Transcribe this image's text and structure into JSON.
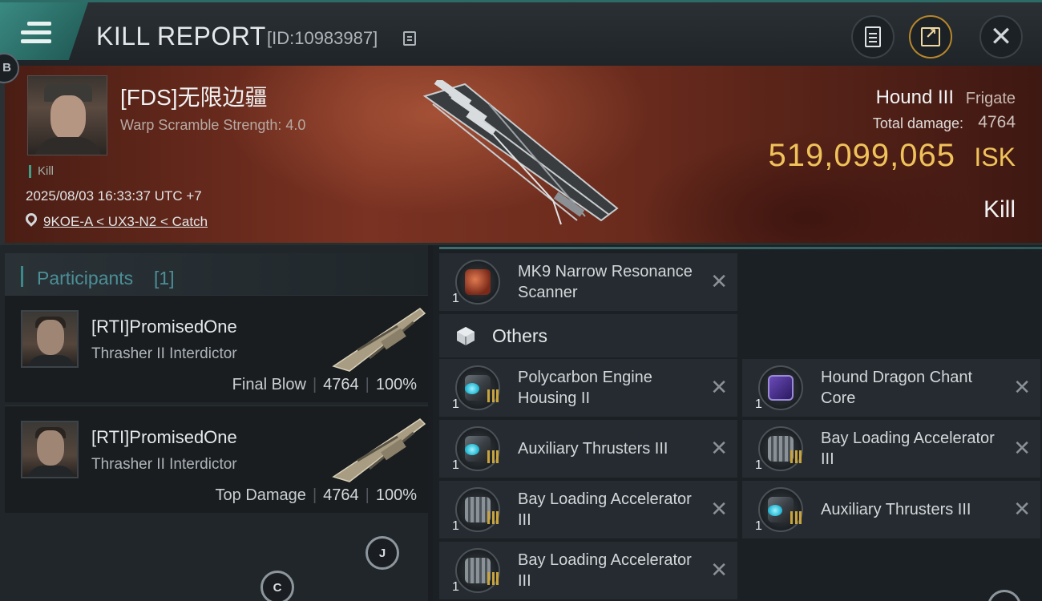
{
  "header": {
    "title": "KILL REPORT",
    "kill_id": "[ID:10983987]",
    "badge_left": "B"
  },
  "victim": {
    "name": "[FDS]无限边疆",
    "subtitle": "Warp Scramble Strength: 4.0",
    "kill_tag": "Kill",
    "timestamp": "2025/08/03 16:33:37 UTC +7",
    "location": "9KOE-A < UX3-N2 < Catch",
    "ship_name": "Hound III",
    "ship_class": "Frigate",
    "total_damage_label": "Total damage:",
    "total_damage": "4764",
    "isk_value": "519,099,065",
    "isk_unit": "ISK",
    "outcome": "Kill"
  },
  "participants": {
    "title": "Participants",
    "count": "[1]",
    "items": [
      {
        "pilot": "[RTI]PromisedOne",
        "ship": "Thrasher II Interdictor",
        "role": "Final Blow",
        "damage": "4764",
        "percent": "100%"
      },
      {
        "pilot": "[RTI]PromisedOne",
        "ship": "Thrasher II Interdictor",
        "role": "Top Damage",
        "damage": "4764",
        "percent": "100%"
      }
    ]
  },
  "badges": {
    "j": "J",
    "c": "C"
  },
  "items_section": {
    "top_item": {
      "name": "MK9 Narrow Resonance Scanner",
      "qty": "1",
      "icon": "scanner-icon"
    },
    "others_title": "Others",
    "others": [
      {
        "name": "Polycarbon Engine Housing II",
        "qty": "1",
        "icon": "engine-icon"
      },
      {
        "name": "Hound Dragon Chant Core",
        "qty": "1",
        "icon": "core-icon"
      },
      {
        "name": "Auxiliary Thrusters III",
        "qty": "1",
        "icon": "thruster-icon"
      },
      {
        "name": "Bay Loading Accelerator III",
        "qty": "1",
        "icon": "bay-loader-icon"
      },
      {
        "name": "Bay Loading Accelerator III",
        "qty": "1",
        "icon": "bay-loader-icon"
      },
      {
        "name": "Auxiliary Thrusters III",
        "qty": "1",
        "icon": "thruster-icon"
      },
      {
        "name": "Bay Loading Accelerator III",
        "qty": "1",
        "icon": "bay-loader-icon"
      }
    ]
  },
  "colors": {
    "accent_teal": "#3a8a82",
    "isk_gold": "#f0c25a",
    "participants_title": "#4b8f97"
  }
}
